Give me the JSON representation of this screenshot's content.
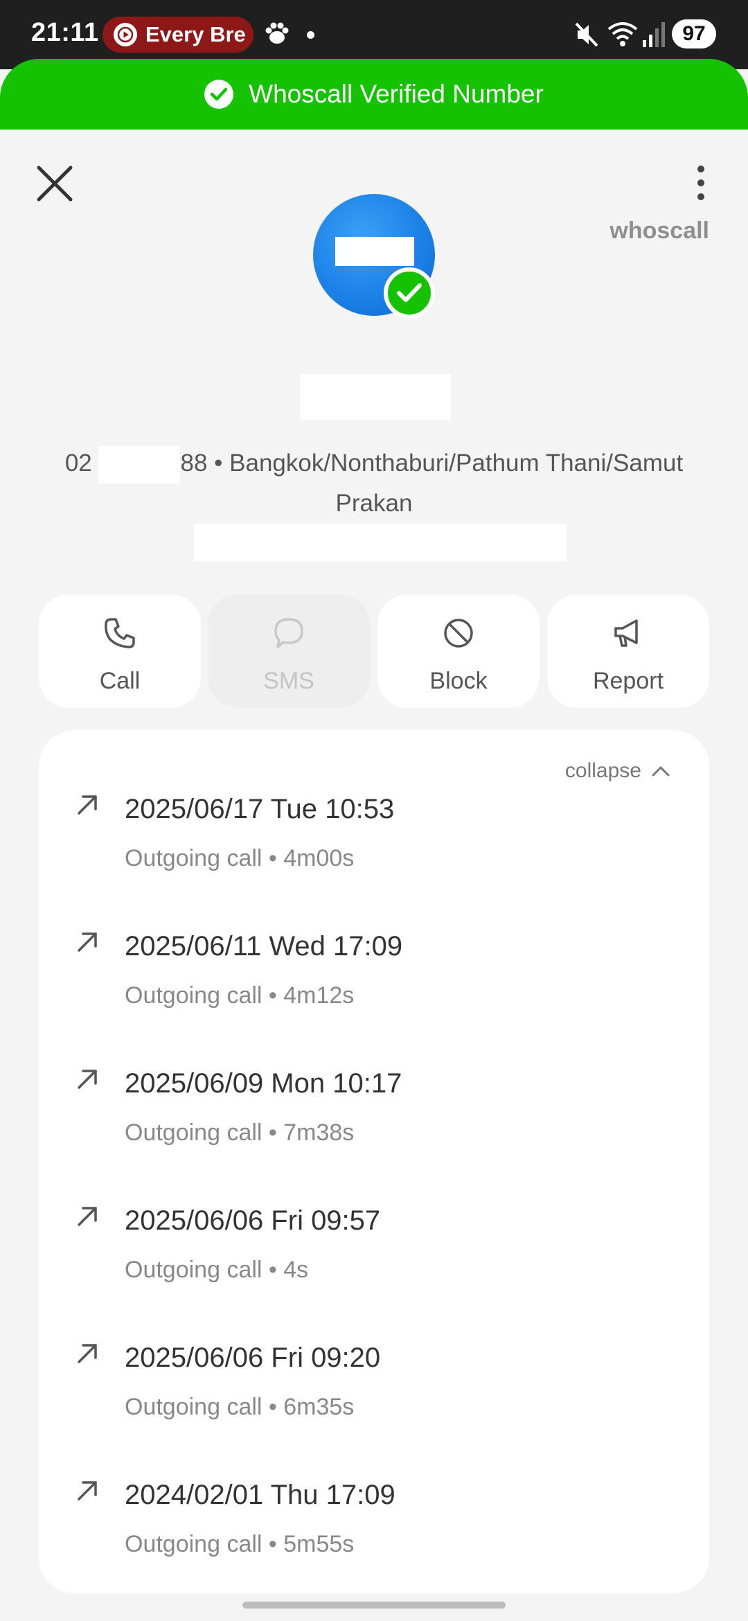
{
  "status_bar": {
    "time": "21:11",
    "media_text": "Every Bre",
    "battery": "97"
  },
  "banner": {
    "text": "Whoscall Verified Number",
    "color": "#14c200"
  },
  "header": {
    "brand": "whoscall"
  },
  "contact": {
    "number_prefix": "02",
    "number_suffix": "88",
    "separator": "•",
    "location": "Bangkok/Nonthaburi/Pathum Thani/Samut Prakan"
  },
  "actions": [
    {
      "label": "Call",
      "icon": "phone-icon",
      "enabled": true
    },
    {
      "label": "SMS",
      "icon": "chat-bubble-icon",
      "enabled": false
    },
    {
      "label": "Block",
      "icon": "block-icon",
      "enabled": true
    },
    {
      "label": "Report",
      "icon": "megaphone-icon",
      "enabled": true
    }
  ],
  "call_log": {
    "collapse_label": "collapse",
    "entries": [
      {
        "date": "2025/06/17 Tue 10:53",
        "meta": "Outgoing call • 4m00s"
      },
      {
        "date": "2025/06/11 Wed 17:09",
        "meta": "Outgoing call • 4m12s"
      },
      {
        "date": "2025/06/09 Mon 10:17",
        "meta": "Outgoing call • 7m38s"
      },
      {
        "date": "2025/06/06 Fri 09:57",
        "meta": "Outgoing call • 4s"
      },
      {
        "date": "2025/06/06 Fri 09:20",
        "meta": "Outgoing call • 6m35s"
      },
      {
        "date": "2024/02/01 Thu 17:09",
        "meta": "Outgoing call • 5m55s"
      }
    ]
  }
}
